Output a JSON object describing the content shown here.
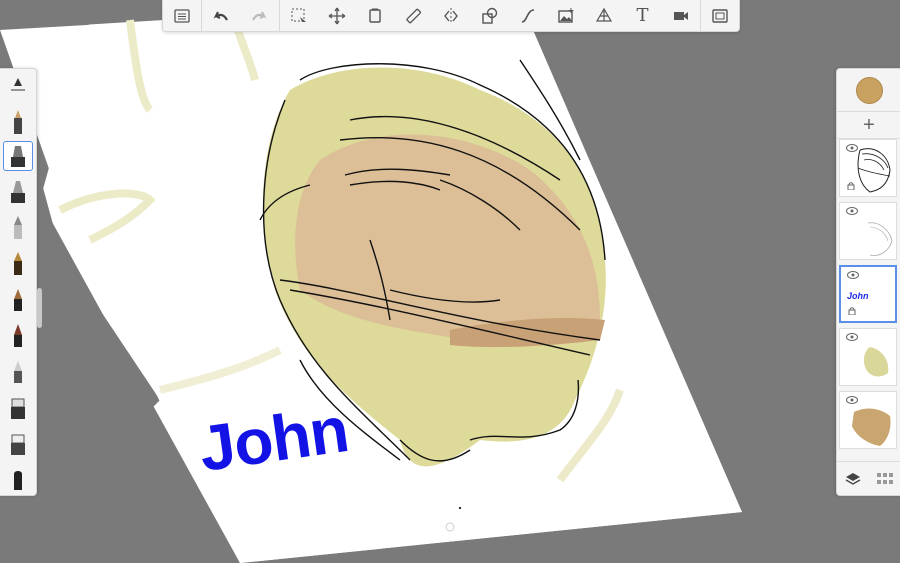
{
  "canvas": {
    "paper_color": "#ffffff",
    "background_color": "#7a7a7a",
    "drawing_text": "John",
    "drawing_text_color": "#1313e6",
    "skin_color": "#dcbf96",
    "hair_color": "#d8d58e"
  },
  "top_toolbar": {
    "buttons": [
      "menu-icon",
      "undo-icon",
      "redo-icon",
      "selection-icon",
      "transform-icon",
      "copy-icon",
      "ruler-icon",
      "symmetry-icon",
      "shapes-icon",
      "curve-icon",
      "image-icon",
      "perspective-icon",
      "text-icon",
      "video-icon",
      "fullscreen-icon"
    ],
    "text_button_label": "T"
  },
  "left_toolbar": {
    "brushes": [
      "brush-settings-icon",
      "pencil-icon",
      "marker-icon",
      "airbrush-icon",
      "paintbrush-icon",
      "pen-icon",
      "ink-icon",
      "crayon-icon",
      "smudge-icon",
      "eraser-icon",
      "fill-icon",
      "blender-icon"
    ],
    "selected_index": 2
  },
  "layers_panel": {
    "current_color": "#c9a160",
    "add_label": "+",
    "layers": [
      {
        "name": "layer-1",
        "text": ""
      },
      {
        "name": "layer-2",
        "text": ""
      },
      {
        "name": "layer-3",
        "text": "John",
        "selected": true
      },
      {
        "name": "layer-4",
        "text": ""
      },
      {
        "name": "layer-5",
        "text": ""
      }
    ]
  }
}
